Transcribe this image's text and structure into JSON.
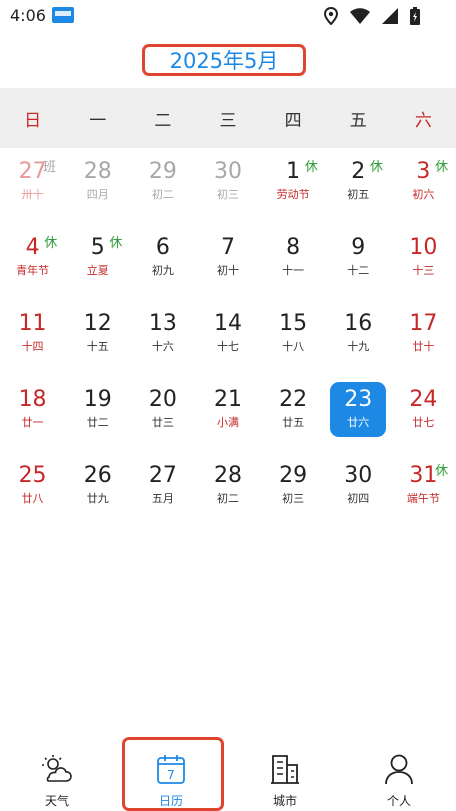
{
  "status": {
    "time": "4:06"
  },
  "header": {
    "month_title": "2025年5月"
  },
  "weekdays": [
    "日",
    "一",
    "二",
    "三",
    "四",
    "五",
    "六"
  ],
  "weeks": [
    [
      {
        "day": "27",
        "lunar": "卅十",
        "other": true,
        "tag": "班"
      },
      {
        "day": "28",
        "lunar": "四月",
        "other": true
      },
      {
        "day": "29",
        "lunar": "初二",
        "other": true
      },
      {
        "day": "30",
        "lunar": "初三",
        "other": true
      },
      {
        "day": "1",
        "lunar": "劳动节",
        "festival": true,
        "tag": "休"
      },
      {
        "day": "2",
        "lunar": "初五",
        "tag": "休"
      },
      {
        "day": "3",
        "lunar": "初六",
        "tag": "休"
      }
    ],
    [
      {
        "day": "4",
        "lunar": "青年节",
        "festival": true,
        "tag": "休"
      },
      {
        "day": "5",
        "lunar": "立夏",
        "festival": true,
        "tag": "休"
      },
      {
        "day": "6",
        "lunar": "初九"
      },
      {
        "day": "7",
        "lunar": "初十"
      },
      {
        "day": "8",
        "lunar": "十一"
      },
      {
        "day": "9",
        "lunar": "十二"
      },
      {
        "day": "10",
        "lunar": "十三"
      }
    ],
    [
      {
        "day": "11",
        "lunar": "十四"
      },
      {
        "day": "12",
        "lunar": "十五"
      },
      {
        "day": "13",
        "lunar": "十六"
      },
      {
        "day": "14",
        "lunar": "十七"
      },
      {
        "day": "15",
        "lunar": "十八"
      },
      {
        "day": "16",
        "lunar": "十九"
      },
      {
        "day": "17",
        "lunar": "廿十"
      }
    ],
    [
      {
        "day": "18",
        "lunar": "廿一"
      },
      {
        "day": "19",
        "lunar": "廿二"
      },
      {
        "day": "20",
        "lunar": "廿三"
      },
      {
        "day": "21",
        "lunar": "小满",
        "festival": true
      },
      {
        "day": "22",
        "lunar": "廿五"
      },
      {
        "day": "23",
        "lunar": "廿六",
        "today": true
      },
      {
        "day": "24",
        "lunar": "廿七"
      }
    ],
    [
      {
        "day": "25",
        "lunar": "廿八"
      },
      {
        "day": "26",
        "lunar": "廿九"
      },
      {
        "day": "27",
        "lunar": "五月"
      },
      {
        "day": "28",
        "lunar": "初二"
      },
      {
        "day": "29",
        "lunar": "初三"
      },
      {
        "day": "30",
        "lunar": "初四"
      },
      {
        "day": "31",
        "lunar": "端午节",
        "festival": true,
        "tag": "休"
      }
    ]
  ],
  "nav": {
    "items": [
      {
        "label": "天气",
        "icon": "weather-icon",
        "active": false
      },
      {
        "label": "日历",
        "icon": "calendar-icon",
        "active": true,
        "icon_text": "7"
      },
      {
        "label": "城市",
        "icon": "city-icon",
        "active": false
      },
      {
        "label": "个人",
        "icon": "person-icon",
        "active": false
      }
    ]
  },
  "colors": {
    "accent": "#1e88e5",
    "weekend": "#c62828",
    "rest_tag": "#2e9d3a",
    "highlight_box": "#e0442f",
    "week_header_bg": "#efefef"
  }
}
